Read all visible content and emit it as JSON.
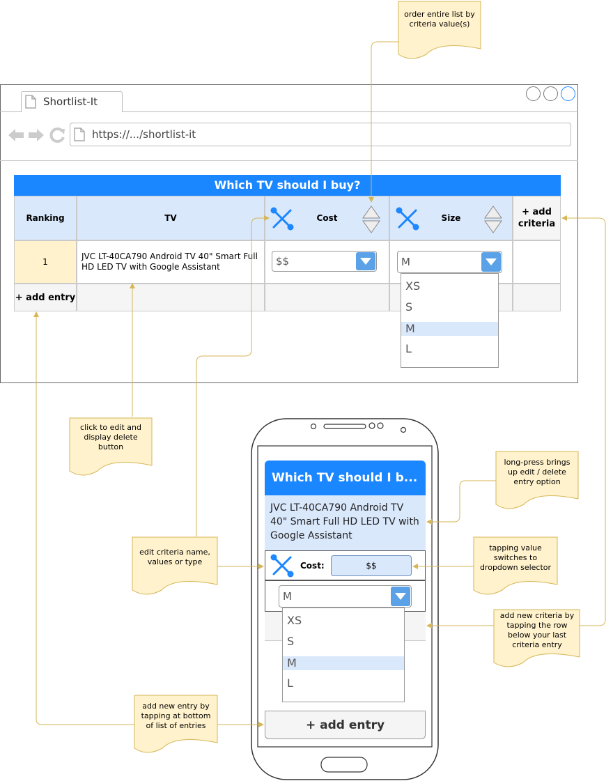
{
  "browser": {
    "tab_label": "Shortlist-It",
    "url": "https://.../shortlist-it"
  },
  "table": {
    "title": "Which TV should I buy?",
    "headers": {
      "ranking": "Ranking",
      "tv": "TV",
      "cost": "Cost",
      "size": "Size",
      "add_criteria": "+ add criteria"
    },
    "row": {
      "rank": "1",
      "tv": "JVC LT-40CA790 Android TV 40\" Smart Full HD LED TV with Google Assistant",
      "cost": "$$",
      "size": "M"
    },
    "add_entry": "+ add entry",
    "size_options": [
      "XS",
      "S",
      "M",
      "L"
    ],
    "size_selected": "M"
  },
  "phone": {
    "title": "Which TV should I b...",
    "entry": "JVC LT-40CA790 Android TV 40\" Smart Full HD LED TV with Google Assistant",
    "cost_label": "Cost:",
    "cost_value": "$$",
    "size_value": "M",
    "size_options": [
      "XS",
      "S",
      "M",
      "L"
    ],
    "size_selected": "M",
    "add_entry": "+ add entry"
  },
  "notes": {
    "order": "order entire list by criteria value(s)",
    "click_edit": "click to edit and display delete button",
    "long_press": "long-press brings up edit / delete entry option",
    "edit_criteria": "edit criteria name, values or type",
    "tapping_value": "tapping value switches to dropdown selector",
    "add_criteria": "add new criteria by tapping the row below your last criteria entry",
    "add_entry": "add new entry by tapping at bottom of list of entries"
  },
  "colors": {
    "header_blue": "#1a86ff",
    "light_blue": "#dae8fc",
    "note_yellow": "#fff2cc",
    "connector": "#d6b656"
  },
  "icons": [
    "back-arrow-icon",
    "forward-arrow-icon",
    "reload-icon",
    "page-icon",
    "tools-icon",
    "sort-arrows-icon",
    "dropdown-arrow-icon"
  ]
}
